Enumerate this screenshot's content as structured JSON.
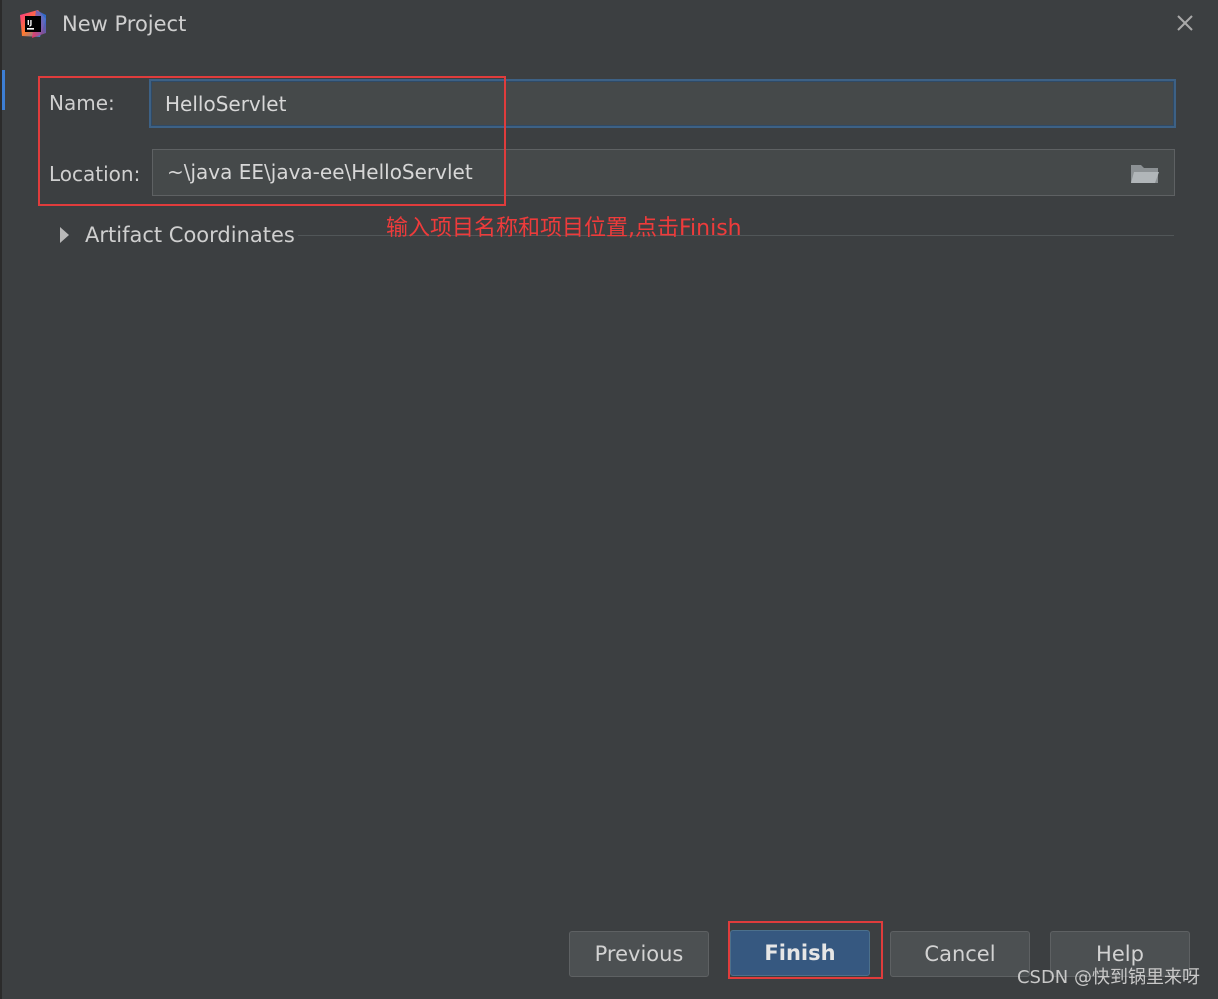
{
  "window": {
    "title": "New Project",
    "logo_text": "IJ"
  },
  "form": {
    "name_label": "Name:",
    "name_value": "HelloServlet",
    "location_label": "Location:",
    "location_value": "~\\java EE\\java-ee\\HelloServlet",
    "artifact_label": "Artifact Coordinates"
  },
  "annotation": {
    "text": "输入项目名称和项目位置,点击Finish",
    "color": "#e03c3c"
  },
  "buttons": {
    "previous": "Previous",
    "finish": "Finish",
    "cancel": "Cancel",
    "help": "Help"
  },
  "watermark": "CSDN @快到锅里来呀",
  "icons": {
    "logo": "intellij-idea-logo-icon",
    "close": "close-icon",
    "folder": "folder-icon",
    "expand": "triangle-right-icon"
  },
  "colors": {
    "background": "#3c3f41",
    "primary_button": "#365880",
    "focus_border": "#3d6185"
  }
}
